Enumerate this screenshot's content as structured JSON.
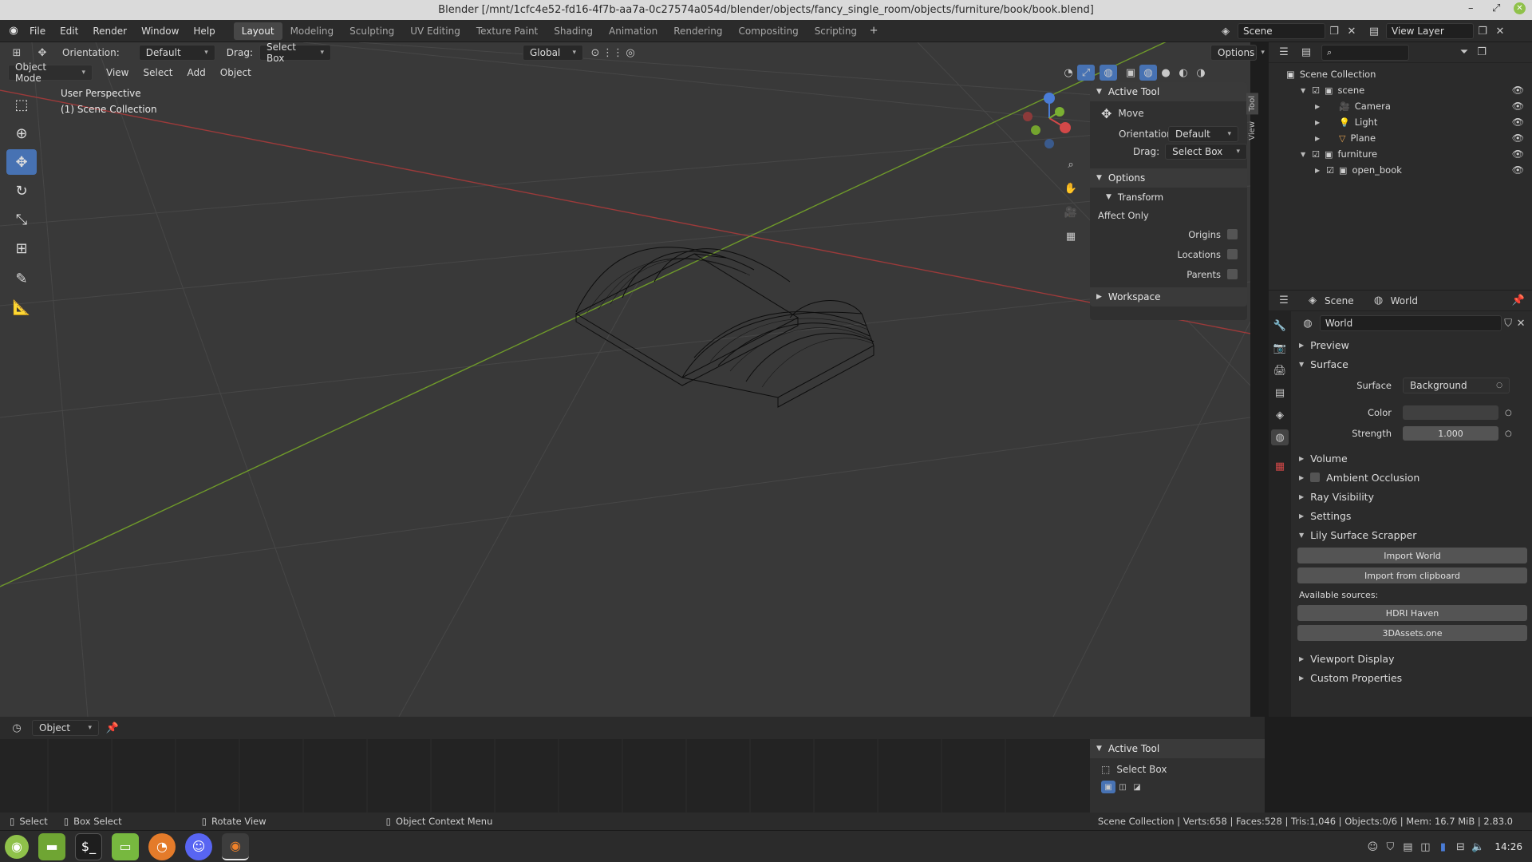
{
  "window_title": "Blender [/mnt/1cfc4e52-fd16-4f7b-aa7a-0c27574a054d/blender/objects/fancy_single_room/objects/furniture/book/book.blend]",
  "menus": [
    "File",
    "Edit",
    "Render",
    "Window",
    "Help"
  ],
  "workspaces": [
    "Layout",
    "Modeling",
    "Sculpting",
    "UV Editing",
    "Texture Paint",
    "Shading",
    "Animation",
    "Rendering",
    "Compositing",
    "Scripting"
  ],
  "active_workspace": "Layout",
  "scene_name": "Scene",
  "view_layer": "View Layer",
  "tool_header": {
    "orientation_label": "Orientation:",
    "orientation_value": "Default",
    "drag_label": "Drag:",
    "drag_value": "Select Box",
    "transform_orientation": "Global",
    "options_label": "Options"
  },
  "viewport_header": {
    "mode": "Object Mode",
    "menus": [
      "View",
      "Select",
      "Add",
      "Object"
    ]
  },
  "viewport_overlay": {
    "perspective": "User Perspective",
    "collection": "(1) Scene Collection"
  },
  "npanel": {
    "tabs": [
      "Tool",
      "View"
    ],
    "active_tool_title": "Active Tool",
    "tool_name": "Move",
    "orientation_label": "Orientation",
    "orientation_value": "Default",
    "drag_label": "Drag:",
    "drag_value": "Select Box",
    "options_title": "Options",
    "transform_title": "Transform",
    "affect_only": "Affect Only",
    "origins": "Origins",
    "locations": "Locations",
    "parents": "Parents",
    "workspace_title": "Workspace"
  },
  "outliner": {
    "root": "Scene Collection",
    "items": [
      {
        "label": "scene",
        "indent": 1
      },
      {
        "label": "Camera",
        "indent": 2
      },
      {
        "label": "Light",
        "indent": 2
      },
      {
        "label": "Plane",
        "indent": 2
      },
      {
        "label": "furniture",
        "indent": 1
      },
      {
        "label": "open_book",
        "indent": 2
      }
    ]
  },
  "properties": {
    "tab_scene": "Scene",
    "tab_world": "World",
    "world_name": "World",
    "sections": {
      "preview": "Preview",
      "surface": "Surface",
      "volume": "Volume",
      "ambient_occlusion": "Ambient Occlusion",
      "ray_visibility": "Ray Visibility",
      "settings": "Settings",
      "lily": "Lily Surface Scrapper",
      "viewport_display": "Viewport Display",
      "custom_properties": "Custom Properties"
    },
    "surface_label": "Surface",
    "surface_value": "Background",
    "color_label": "Color",
    "strength_label": "Strength",
    "strength_value": "1.000",
    "import_world": "Import World",
    "import_clipboard": "Import from clipboard",
    "available_sources": "Available sources:",
    "source1": "HDRI Haven",
    "source2": "3DAssets.one"
  },
  "timeline": {
    "editor": "Object",
    "active_tool_title": "Active Tool",
    "tool_name": "Select Box"
  },
  "statusbar": {
    "select": "Select",
    "box_select": "Box Select",
    "rotate_view": "Rotate View",
    "context_menu": "Object Context Menu",
    "stats": "Scene Collection | Verts:658 | Faces:528 | Tris:1,046 | Objects:0/6 | Mem: 16.7 MiB | 2.83.0"
  },
  "taskbar": {
    "time": "14:26"
  },
  "colors": {
    "accent": "#4772b3",
    "x_axis": "#9c3a3a",
    "y_axis": "#6f9a2a",
    "viewport_bg": "#393939"
  }
}
